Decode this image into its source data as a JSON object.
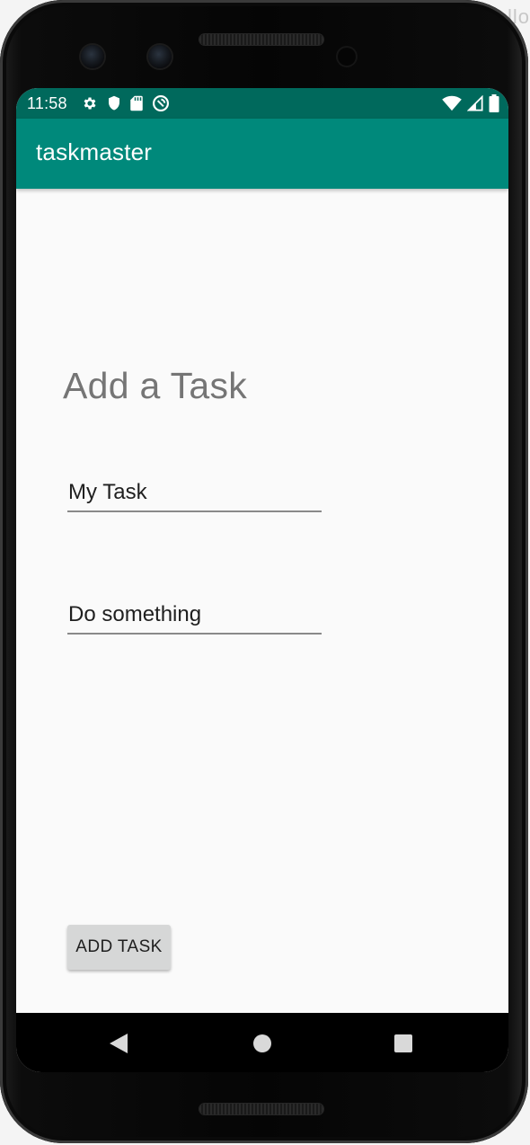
{
  "background_hint": "llo",
  "status_bar": {
    "time": "11:58",
    "left_icons": [
      "gear-icon",
      "shield-icon",
      "sd-card-icon",
      "sync-icon"
    ],
    "right_icons": [
      "wifi-icon",
      "cell-signal-icon",
      "battery-icon"
    ]
  },
  "app_bar": {
    "title": "taskmaster"
  },
  "form": {
    "heading": "Add a Task",
    "title_field": {
      "value": "My Task"
    },
    "body_field": {
      "value": "Do something"
    },
    "submit_label": "ADD TASK"
  },
  "nav_bar": {
    "buttons": [
      "back-icon",
      "home-icon",
      "recents-icon"
    ]
  },
  "colors": {
    "status_bar": "#00695c",
    "app_bar": "#00897b",
    "screen_bg": "#fafafa",
    "heading_text": "#757575",
    "button_bg": "#d6d7d7",
    "nav_bar": "#000000"
  }
}
